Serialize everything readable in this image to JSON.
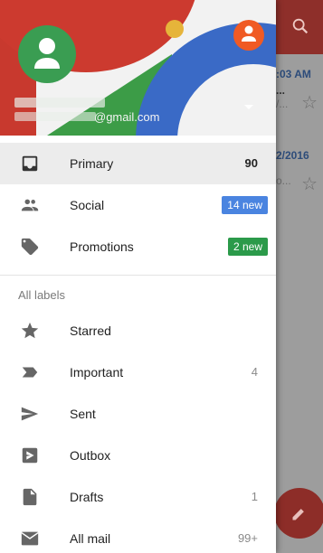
{
  "background": {
    "search_icon": "search-icon",
    "rows": [
      {
        "time": ":03 AM",
        "snippet": "...",
        "snippet2": "/..."
      },
      {
        "time": "2/2016",
        "snippet": "",
        "snippet2": "o..."
      }
    ]
  },
  "account": {
    "email_suffix": "@gmail.com"
  },
  "mailboxes": [
    {
      "label": "Primary",
      "count": "90",
      "selected": true
    },
    {
      "label": "Social",
      "badge": "14 new"
    },
    {
      "label": "Promotions",
      "badge": "2 new"
    }
  ],
  "labels_title": "All labels",
  "labels": [
    {
      "label": "Starred",
      "count": ""
    },
    {
      "label": "Important",
      "count": "4"
    },
    {
      "label": "Sent",
      "count": ""
    },
    {
      "label": "Outbox",
      "count": ""
    },
    {
      "label": "Drafts",
      "count": "1"
    },
    {
      "label": "All mail",
      "count": "99+"
    }
  ],
  "colors": {
    "social_badge": "#4a84e0",
    "promotions_badge": "#2b9a4a",
    "header_red": "#c8392e",
    "avatar_green": "#3a9d52",
    "avatar_orange": "#f05a24"
  }
}
